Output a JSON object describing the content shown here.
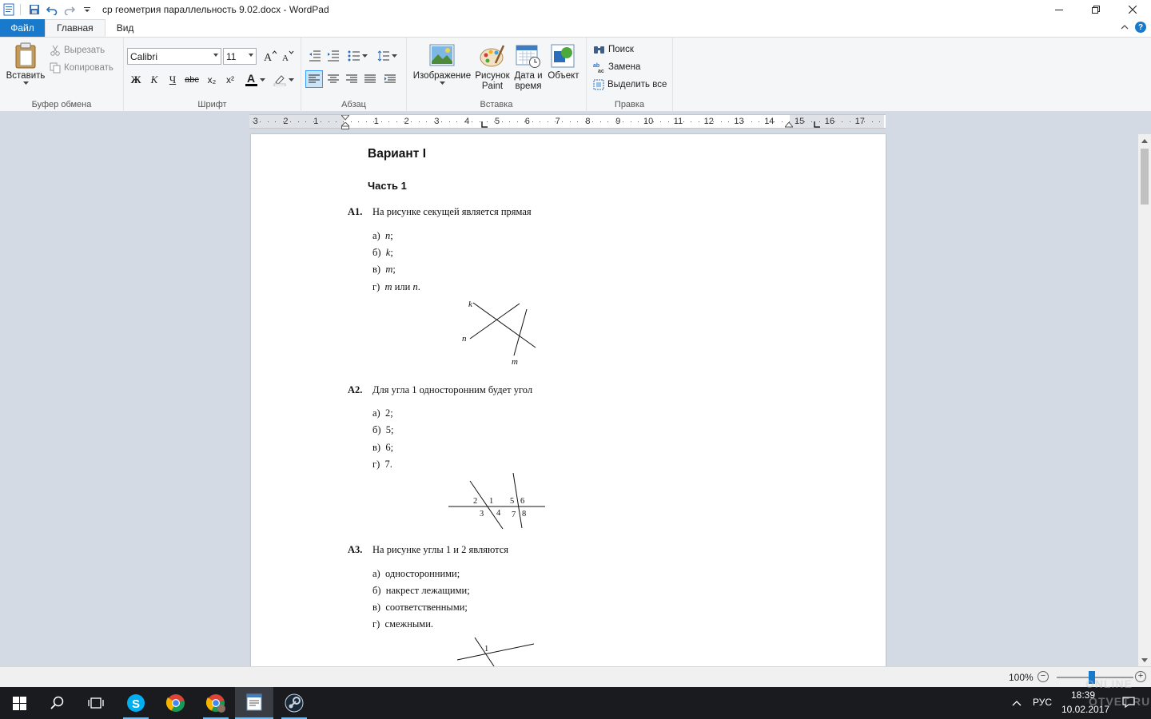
{
  "window": {
    "title": "ср геометрия параллельность 9.02.docx - WordPad"
  },
  "tabs": {
    "file": "Файл",
    "home": "Главная",
    "view": "Вид"
  },
  "ribbon": {
    "clipboard": {
      "paste": "Вставить",
      "cut": "Вырезать",
      "copy": "Копировать",
      "label": "Буфер обмена"
    },
    "font": {
      "family": "Calibri",
      "size": "11",
      "label": "Шрифт",
      "bold": "Ж",
      "italic": "К",
      "underline": "Ч",
      "strike": "abc",
      "sub": "x₂",
      "sup": "x²",
      "color_glyph": "A"
    },
    "paragraph": {
      "label": "Абзац"
    },
    "insert": {
      "image": "Изображение",
      "paint_line1": "Рисунок",
      "paint_line2": "Paint",
      "datetime_line1": "Дата и",
      "datetime_line2": "время",
      "object": "Объект",
      "label": "Вставка"
    },
    "editing": {
      "find": "Поиск",
      "replace": "Замена",
      "select_all": "Выделить все",
      "label": "Правка"
    }
  },
  "ruler": {
    "left_numbers": [
      "3",
      "2",
      "1"
    ],
    "right_numbers": [
      "1",
      "2",
      "3",
      "4",
      "5",
      "6",
      "7",
      "8",
      "9",
      "10",
      "11",
      "12",
      "13",
      "14",
      "15",
      "16",
      "17"
    ]
  },
  "document": {
    "variant": "Вариант I",
    "part": "Часть 1",
    "q1": {
      "label": "А1.",
      "text": "На рисунке секущей является прямая",
      "options": [
        {
          "letter": "а)",
          "var": "n",
          "rest": ";"
        },
        {
          "letter": "б)",
          "var": "k",
          "rest": ";"
        },
        {
          "letter": "в)",
          "var": "m",
          "rest": ";"
        },
        {
          "letter": "г)",
          "var": "m",
          "mid": " или ",
          "var2": "n",
          "rest": "."
        }
      ],
      "figure_labels": {
        "k": "k",
        "n": "n",
        "m": "m"
      }
    },
    "q2": {
      "label": "А2.",
      "text": "Для угла 1 односторонним будет угол",
      "options": [
        {
          "letter": "а)",
          "text": "2;"
        },
        {
          "letter": "б)",
          "text": "5;"
        },
        {
          "letter": "в)",
          "text": "6;"
        },
        {
          "letter": "г)",
          "text": "7."
        }
      ],
      "figure_labels": [
        "2",
        "1",
        "3",
        "4",
        "5",
        "6",
        "7",
        "8"
      ]
    },
    "q3": {
      "label": "А3.",
      "text": "На рисунке углы 1 и 2 являются",
      "options": [
        {
          "letter": "а)",
          "text": "односторонними;"
        },
        {
          "letter": "б)",
          "text": "накрест лежащими;"
        },
        {
          "letter": "в)",
          "text": "соответственными;"
        },
        {
          "letter": "г)",
          "text": "смежными."
        }
      ],
      "figure_labels": [
        "1"
      ]
    }
  },
  "statusbar": {
    "zoom": "100%",
    "zoom_level_percent": 100
  },
  "taskbar": {
    "lang": "РУС",
    "time": "18:39",
    "date": "10.02.2017"
  },
  "watermark": {
    "line1": "ONLINE",
    "line2": "OTVET.RU"
  },
  "colors": {
    "accent": "#1979ca",
    "workspace": "#d4dae3",
    "taskbar": "#1a1b1f"
  }
}
